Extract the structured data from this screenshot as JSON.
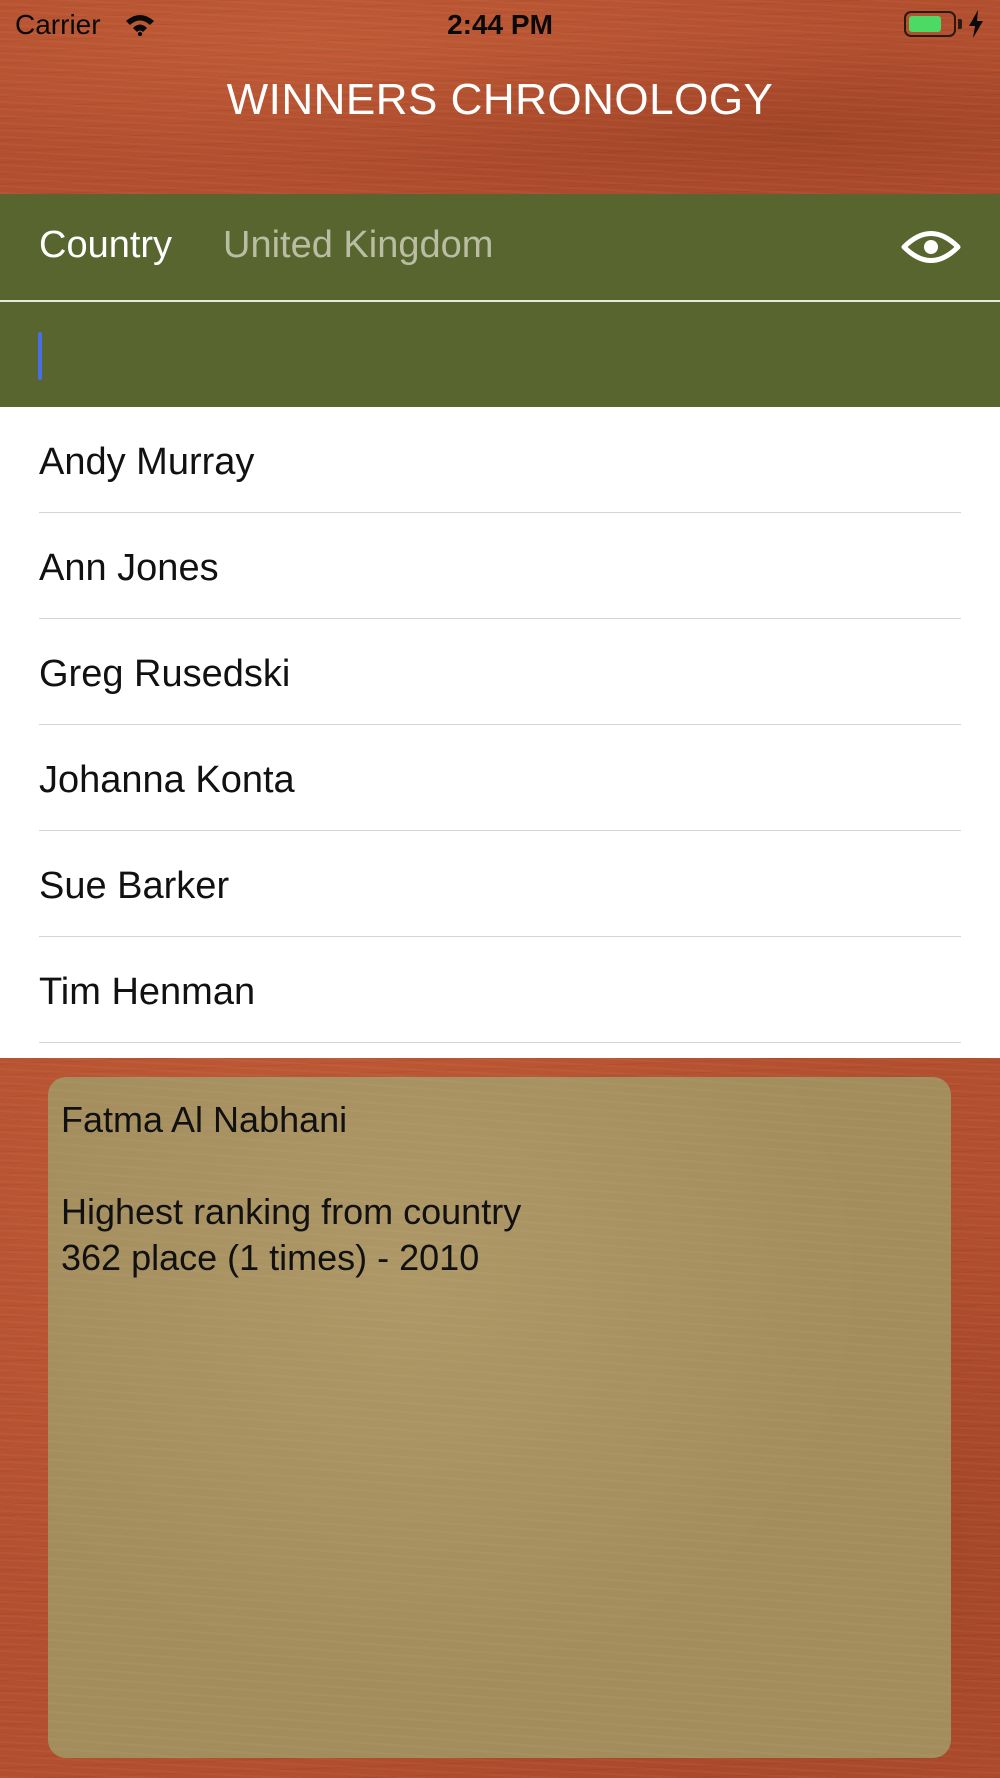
{
  "status_bar": {
    "carrier": "Carrier",
    "time": "2:44 PM",
    "battery_level": 0.75,
    "wifi_icon": "wifi-icon",
    "charging_icon": "bolt-icon"
  },
  "header": {
    "title": "WINNERS CHRONOLOGY"
  },
  "filter": {
    "label": "Country",
    "value": "United Kingdom",
    "toggle_icon": "eye-icon"
  },
  "search": {
    "value": ""
  },
  "players": [
    {
      "name": "Andy Murray"
    },
    {
      "name": "Ann Jones"
    },
    {
      "name": "Greg Rusedski"
    },
    {
      "name": "Johanna Konta"
    },
    {
      "name": "Sue Barker"
    },
    {
      "name": "Tim Henman"
    }
  ],
  "info": {
    "player": "Fatma Al Nabhani",
    "heading": "Highest ranking from country",
    "detail": "362 place (1 times) - 2010"
  },
  "colors": {
    "clay": "#b24f2e",
    "green_bar": "#59652e",
    "card": "#a38d5d",
    "cursor": "#4a6ee8"
  }
}
